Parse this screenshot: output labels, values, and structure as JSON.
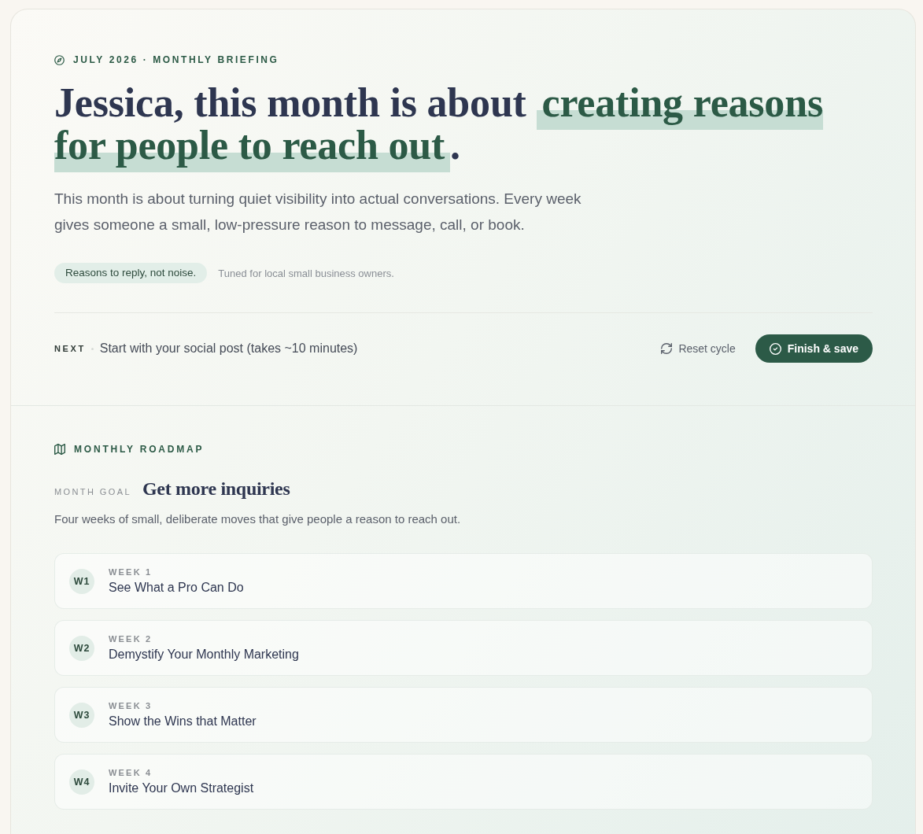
{
  "briefing": {
    "eyebrow": "JULY 2026 · MONTHLY BRIEFING",
    "headline": {
      "lead": "Jessica, this month is about",
      "highlight": "creating reasons for people to reach out",
      "tail": "."
    },
    "summary": "This month is about turning quiet visibility into actual conversations. Every week gives someone a small, low-pressure reason to message, call, or book.",
    "tag": "Reasons to reply, not noise.",
    "note": "Tuned for local small business owners.",
    "next": {
      "label": "NEXT",
      "text": "Start with your social post (takes ~10 minutes)"
    },
    "actions": [
      {
        "kind": "ghost",
        "label": "Reset cycle"
      },
      {
        "kind": "primary",
        "label": "Finish & save"
      }
    ]
  },
  "roadmap": {
    "title": "MONTHLY ROADMAP",
    "goal_label": "MONTH GOAL",
    "goal": "Get more inquiries",
    "description": "Four weeks of small, deliberate moves that give people a reason to reach out.",
    "weeks": [
      {
        "badge": "W1",
        "label": "WEEK 1",
        "title": "See What a Pro Can Do"
      },
      {
        "badge": "W2",
        "label": "WEEK 2",
        "title": "Demystify Your Monthly Marketing"
      },
      {
        "badge": "W3",
        "label": "WEEK 3",
        "title": "Show the Wins that Matter"
      },
      {
        "badge": "W4",
        "label": "WEEK 4",
        "title": "Invite Your Own Strategist"
      }
    ]
  }
}
